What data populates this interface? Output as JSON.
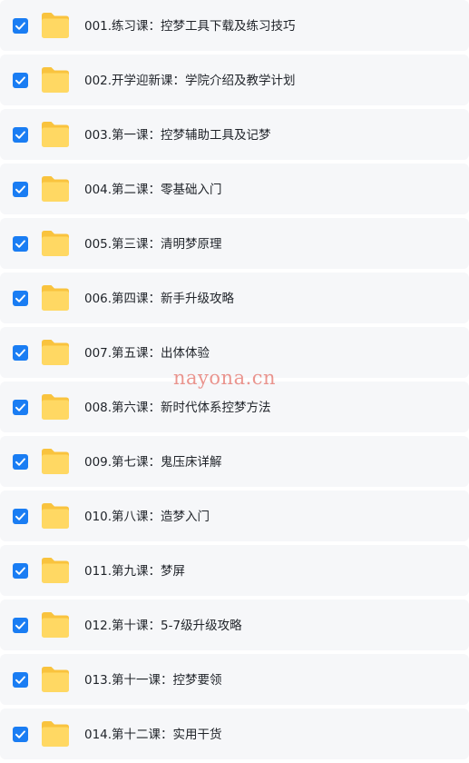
{
  "files": [
    {
      "name": "001.练习课：控梦工具下载及练习技巧",
      "checked": true
    },
    {
      "name": "002.开学迎新课：学院介绍及教学计划",
      "checked": true
    },
    {
      "name": "003.第一课：控梦辅助工具及记梦",
      "checked": true
    },
    {
      "name": "004.第二课：零基础入门",
      "checked": true
    },
    {
      "name": "005.第三课：清明梦原理",
      "checked": true
    },
    {
      "name": "006.第四课：新手升级攻略",
      "checked": true
    },
    {
      "name": "007.第五课：出体体验",
      "checked": true
    },
    {
      "name": "008.第六课：新时代体系控梦方法",
      "checked": true
    },
    {
      "name": "009.第七课：鬼压床详解",
      "checked": true
    },
    {
      "name": "010.第八课：造梦入门",
      "checked": true
    },
    {
      "name": "011.第九课：梦屏",
      "checked": true
    },
    {
      "name": "012.第十课：5-7级升级攻略",
      "checked": true
    },
    {
      "name": "013.第十一课：控梦要领",
      "checked": true
    },
    {
      "name": "014.第十二课：实用干货",
      "checked": true
    }
  ],
  "icons": {
    "checkbox": "checkbox-checked-icon",
    "folder": "folder-icon"
  },
  "colors": {
    "checkbox": "#1a7df3",
    "folder_back": "#f9c33e",
    "folder_front": "#ffd863",
    "row_background": "#f6f7f9",
    "watermark": "#e2574c"
  },
  "watermark": "nayona.cn"
}
